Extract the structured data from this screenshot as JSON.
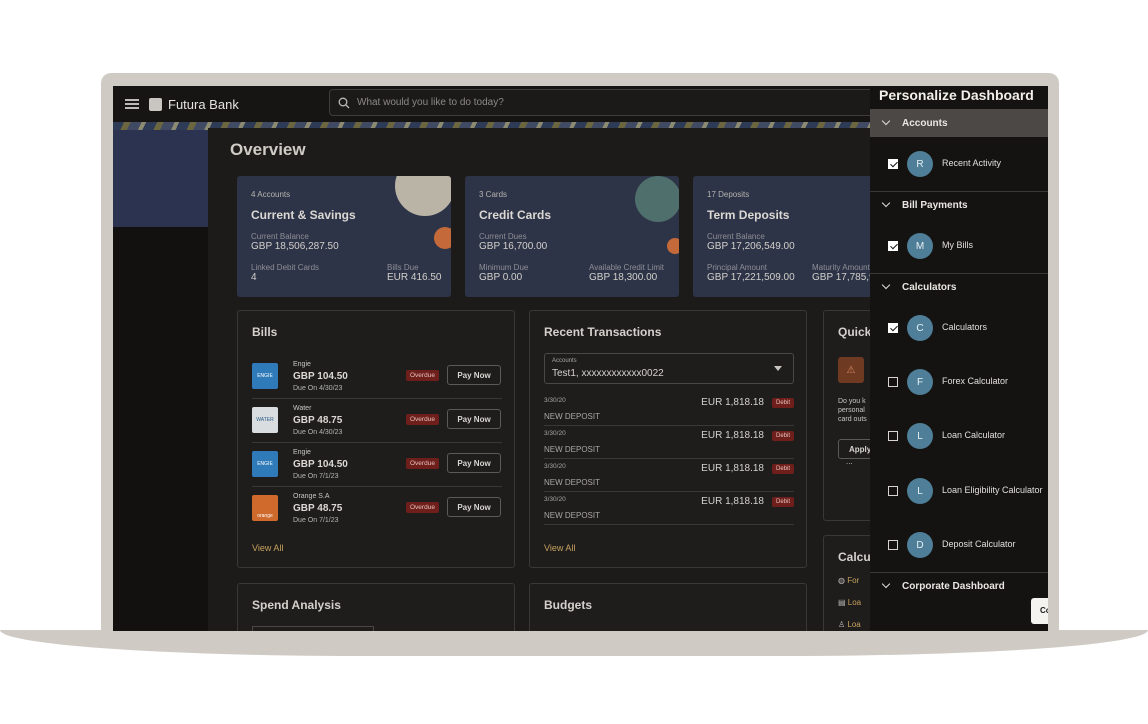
{
  "header": {
    "brand": "Futura Bank",
    "search_placeholder": "What would you like to do today?"
  },
  "overview": {
    "title": "Overview",
    "cards": [
      {
        "count": "4 Accounts",
        "name": "Current & Savings",
        "l1": "Current Balance",
        "v1": "GBP 18,506,287.50",
        "l2": "Linked Debit Cards",
        "v2": "4",
        "l3": "Bills Due",
        "v3": "EUR 416.50"
      },
      {
        "count": "3 Cards",
        "name": "Credit Cards",
        "l1": "Current Dues",
        "v1": "GBP 16,700.00",
        "l2": "Minimum Due",
        "v2": "GBP 0.00",
        "l3": "Available Credit Limit",
        "v3": "GBP 18,300.00"
      },
      {
        "count": "17 Deposits",
        "name": "Term Deposits",
        "l1": "Current Balance",
        "v1": "GBP 17,206,549.00",
        "l2": "Principal Amount",
        "v2": "GBP 17,221,509.00",
        "l3": "Maturity Amount",
        "v3": "GBP 17,785,9"
      }
    ]
  },
  "bills": {
    "title": "Bills",
    "items": [
      {
        "logo": "ENGIE",
        "name": "Engie",
        "amount": "GBP 104.50",
        "due": "Due On 4/30/23",
        "status": "Overdue",
        "action": "Pay Now"
      },
      {
        "logo": "WATER",
        "name": "Water",
        "amount": "GBP 48.75",
        "due": "Due On 4/30/23",
        "status": "Overdue",
        "action": "Pay Now"
      },
      {
        "logo": "ENGIE",
        "name": "Engie",
        "amount": "GBP 104.50",
        "due": "Due On 7/1/23",
        "status": "Overdue",
        "action": "Pay Now"
      },
      {
        "logo": "orange",
        "name": "Orange S.A",
        "amount": "GBP 48.75",
        "due": "Due On 7/1/23",
        "status": "Overdue",
        "action": "Pay Now"
      }
    ],
    "view_all": "View All"
  },
  "transactions": {
    "title": "Recent Transactions",
    "account_label": "Accounts",
    "account_value": "Test1, xxxxxxxxxxxx0022",
    "items": [
      {
        "date": "3/30/20",
        "desc": "NEW DEPOSIT",
        "amount": "EUR 1,818.18",
        "type": "Debit"
      },
      {
        "date": "3/30/20",
        "desc": "NEW DEPOSIT",
        "amount": "EUR 1,818.18",
        "type": "Debit"
      },
      {
        "date": "3/30/20",
        "desc": "NEW DEPOSIT",
        "amount": "EUR 1,818.18",
        "type": "Debit"
      },
      {
        "date": "3/30/20",
        "desc": "NEW DEPOSIT",
        "amount": "EUR 1,818.18",
        "type": "Debit"
      }
    ],
    "view_all": "View All"
  },
  "quick": {
    "title": "Quick",
    "line1": "Do you k",
    "line2": "personal",
    "line3": "card outs",
    "apply": "Apply",
    "more": "..."
  },
  "calculators_widget": {
    "title": "Calcu",
    "items": [
      "For",
      "Loa",
      "Loa"
    ]
  },
  "spend": {
    "title": "Spend Analysis"
  },
  "budgets": {
    "title": "Budgets"
  },
  "panel": {
    "title": "Personalize Dashboard",
    "sections": [
      {
        "name": "Accounts",
        "items": [
          {
            "initial": "R",
            "label": "Recent Activity",
            "checked": true
          }
        ]
      },
      {
        "name": "Bill Payments",
        "items": [
          {
            "initial": "M",
            "label": "My Bills",
            "checked": true
          }
        ]
      },
      {
        "name": "Calculators",
        "items": [
          {
            "initial": "C",
            "label": "Calculators",
            "checked": true
          },
          {
            "initial": "F",
            "label": "Forex Calculator",
            "checked": false
          },
          {
            "initial": "L",
            "label": "Loan Calculator",
            "checked": false
          },
          {
            "initial": "L",
            "label": "Loan Eligibility Calculator",
            "checked": false
          },
          {
            "initial": "D",
            "label": "Deposit Calculator",
            "checked": false
          }
        ]
      },
      {
        "name": "Corporate Dashboard",
        "items": []
      }
    ],
    "button": "Co"
  },
  "colors": {
    "accent": "#c7a25e",
    "avatar": "#4f7f98",
    "overdue": "#6e1f1b",
    "card": "#2e3447"
  }
}
